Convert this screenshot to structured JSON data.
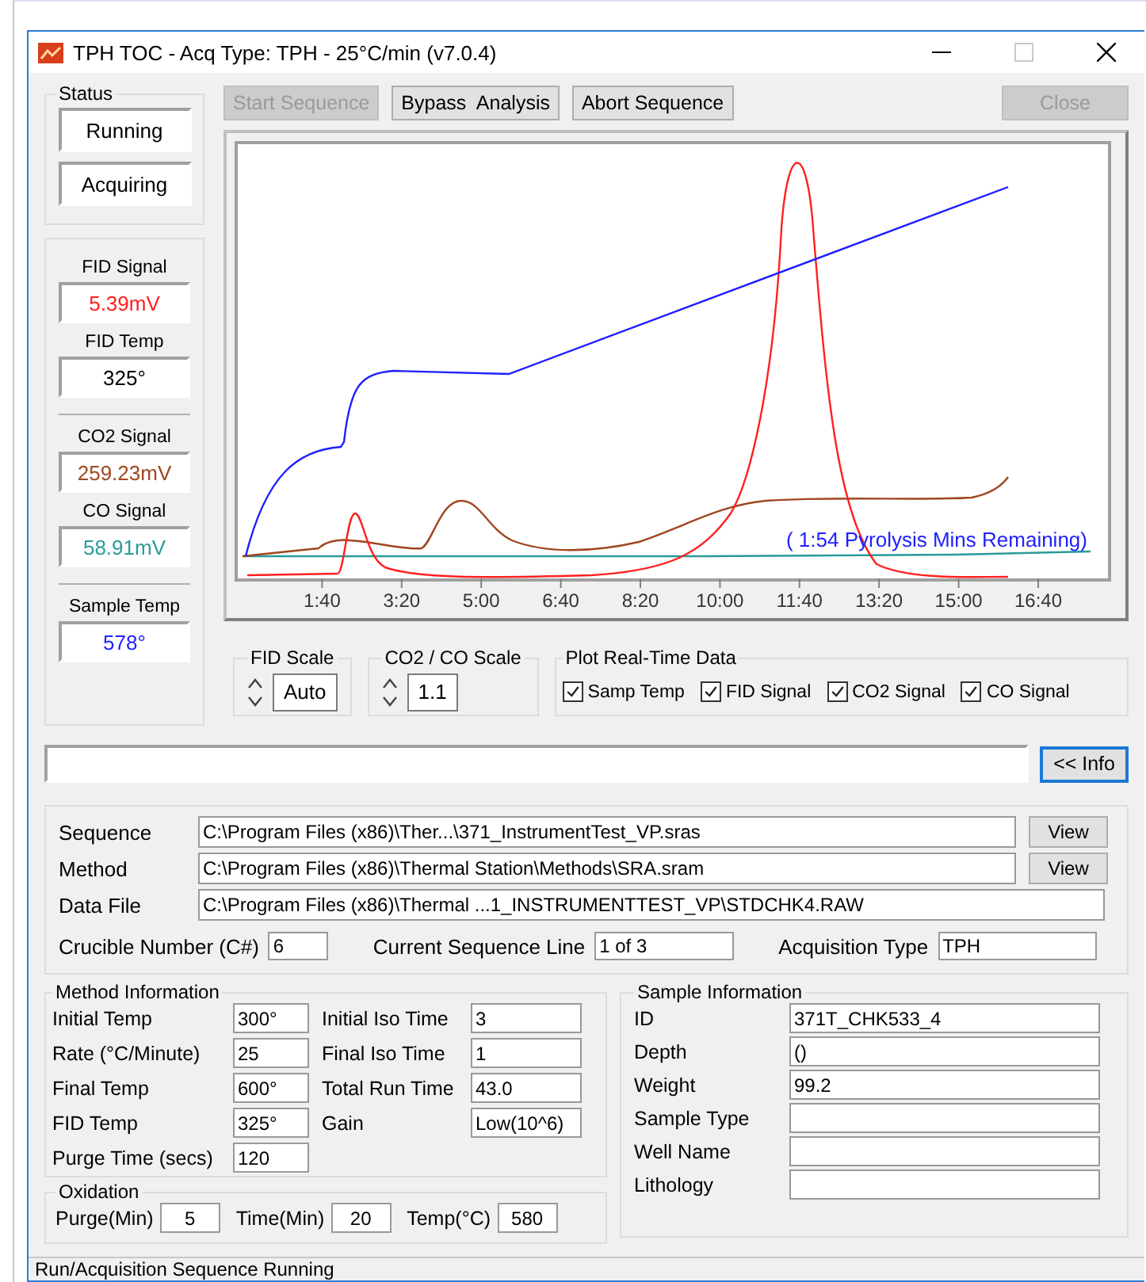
{
  "window": {
    "title": "TPH TOC - Acq Type: TPH - 25°C/min (v7.0.4)"
  },
  "status": {
    "label": "Status",
    "items": [
      "Running",
      "Acquiring"
    ]
  },
  "signals": [
    {
      "label": "FID Signal",
      "value": "5.39mV",
      "color": "#ff2020"
    },
    {
      "label": "FID Temp",
      "value": "325°",
      "color": "#000000"
    },
    {
      "label": "CO2 Signal",
      "value": "259.23mV",
      "color": "#a0461e"
    },
    {
      "label": "CO Signal",
      "value": "58.91mV",
      "color": "#2a9a9a"
    },
    {
      "label": "Sample Temp",
      "value": "578°",
      "color": "#2020ff"
    }
  ],
  "toolbar": [
    {
      "label": "Start Sequence",
      "disabled": true
    },
    {
      "label": "Bypass  Analysis",
      "disabled": false
    },
    {
      "label": "Abort Sequence",
      "disabled": false
    }
  ],
  "close_button": {
    "label": "Close",
    "disabled": true
  },
  "chart": {
    "x_tick_labels": [
      "1:40",
      "3:20",
      "5:00",
      "6:40",
      "8:20",
      "10:00",
      "11:40",
      "13:20",
      "15:00",
      "16:40"
    ],
    "remaining_text": "( 1:54 Pyrolysis Mins Remaining)"
  },
  "fid_scale": {
    "label": "FID Scale",
    "value": "Auto"
  },
  "co_scale": {
    "label": "CO2 / CO Scale",
    "value": "1.1"
  },
  "plot_realtime": {
    "label": "Plot Real-Time Data",
    "options": [
      {
        "label": "Samp Temp",
        "checked": true
      },
      {
        "label": "FID Signal",
        "checked": true
      },
      {
        "label": "CO2 Signal",
        "checked": true
      },
      {
        "label": "CO Signal",
        "checked": true
      }
    ]
  },
  "info_button": {
    "label": "<< Info",
    "focused": true
  },
  "files": [
    {
      "label": "Sequence",
      "value": "C:\\Program Files (x86)\\Ther...\\371_InstrumentTest_VP.sras",
      "button": "View"
    },
    {
      "label": "Method",
      "value": "C:\\Program Files (x86)\\Thermal Station\\Methods\\SRA.sram",
      "button": "View"
    },
    {
      "label": "Data File",
      "value": "C:\\Program Files (x86)\\Thermal ...1_INSTRUMENTTEST_VP\\STDCHK4.RAW"
    }
  ],
  "run_info": [
    {
      "label": "Crucible Number (C#)",
      "value": "6"
    },
    {
      "label": "Current Sequence Line",
      "value": "1 of 3"
    },
    {
      "label": "Acquisition Type",
      "value": "TPH"
    }
  ],
  "method_information": {
    "label": "Method Information",
    "left": [
      {
        "label": "Initial Temp",
        "value": "300°"
      },
      {
        "label": "Rate (°C/Minute)",
        "value": "25"
      },
      {
        "label": "Final Temp",
        "value": "600°"
      },
      {
        "label": "FID Temp",
        "value": "325°"
      },
      {
        "label": "Purge Time (secs)",
        "value": "120"
      }
    ],
    "right": [
      {
        "label": "Initial Iso Time",
        "value": "3"
      },
      {
        "label": "Final Iso Time",
        "value": "1"
      },
      {
        "label": "Total Run Time",
        "value": "43.0"
      },
      {
        "label": "Gain",
        "value": "Low(10^6)"
      }
    ]
  },
  "oxidation": {
    "label": "Oxidation",
    "fields": [
      {
        "label": "Purge(Min)",
        "value": "5"
      },
      {
        "label": "Time(Min)",
        "value": "20"
      },
      {
        "label": "Temp(°C)",
        "value": "580"
      }
    ]
  },
  "sample_information": {
    "label": "Sample Information",
    "fields": [
      {
        "label": "ID",
        "value": "371T_CHK533_4"
      },
      {
        "label": "Depth",
        "value": "()"
      },
      {
        "label": "Weight",
        "value": "99.2"
      },
      {
        "label": "Sample Type"
      },
      {
        "label": "Well Name"
      },
      {
        "label": "Lithology"
      }
    ]
  },
  "status_bar": "Run/Acquisition Sequence Running"
}
